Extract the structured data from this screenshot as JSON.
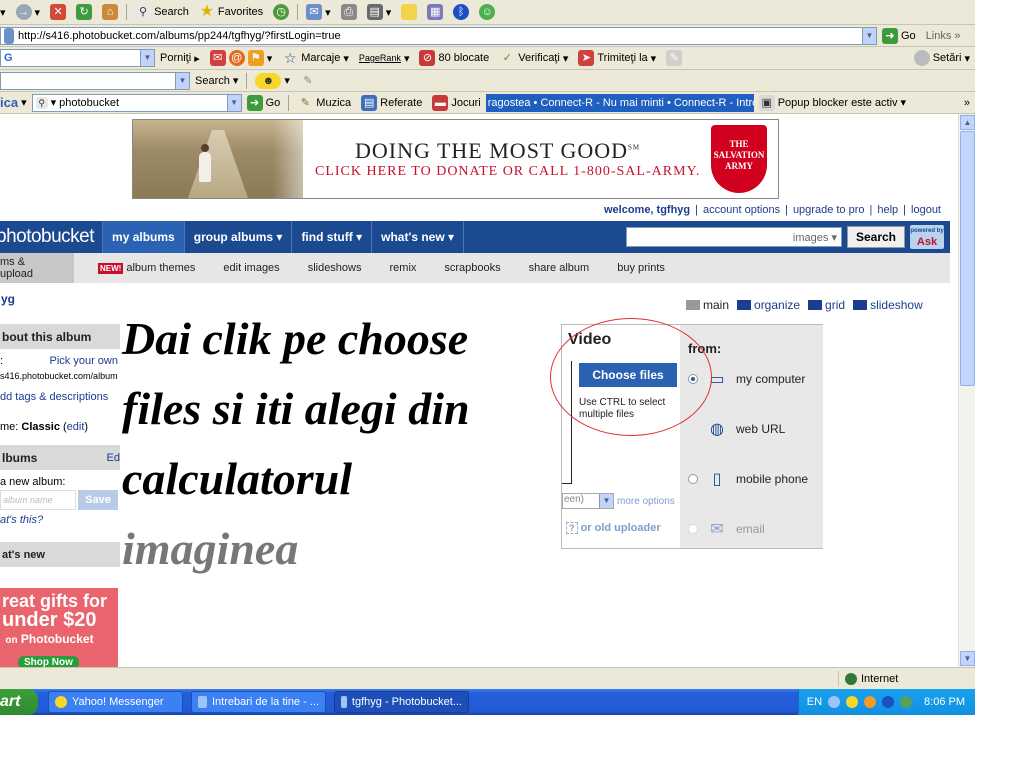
{
  "toolbar1": {
    "search": "Search",
    "favorites": "Favorites"
  },
  "address": {
    "url": "http://s416.photobucket.com/albums/pp244/tgfhyg/?firstLogin=true",
    "go": "Go",
    "links": "Links"
  },
  "google_bar": {
    "engine": "G",
    "porniti": "Porniţi",
    "marcaje": "Marcaje",
    "pagerank": "PageRank",
    "blocate": "80 blocate",
    "verificati": "Verificaţi",
    "trimiteti": "Trimiteţi la",
    "setari": "Setări"
  },
  "search_bar": {
    "search": "Search"
  },
  "links_bar": {
    "left": "ica",
    "search_value": "photobucket",
    "go": "Go",
    "muzica": "Muzica",
    "referate": "Referate",
    "jocuri": "Jocuri",
    "ticker": "ragostea • Connect-R - Nu mai minti • Connect-R - Intro",
    "popup": "Popup blocker este activ"
  },
  "banner": {
    "headline": "Doing the most good",
    "sm": "SM",
    "subline": "Click here to donate or call 1-800-Sal-Army.",
    "logo": "THE SALVATION ARMY"
  },
  "welcome": {
    "greeting": "welcome, tgfhyg",
    "account": "account options",
    "upgrade": "upgrade to pro",
    "help": "help",
    "logout": "logout",
    "sep": "|"
  },
  "nav": {
    "logo": "photobucket",
    "tabs": [
      "my albums",
      "group albums ▾",
      "find stuff ▾",
      "what's new ▾"
    ],
    "search_scope": "images ▾",
    "search_btn": "Search",
    "powered": "powered by",
    "ask": "Ask"
  },
  "subnav": {
    "items": [
      "ms & upload",
      "album themes",
      "edit images",
      "slideshows",
      "remix",
      "scrapbooks",
      "share album",
      "buy prints"
    ],
    "new_badge": "NEW!"
  },
  "sidebar": {
    "user": "yg",
    "about_header": "bout this album",
    "pick_label": ":",
    "pick_link": "Pick your own",
    "url": "s416.photobucket.com/album",
    "tags_link": "dd tags & descriptions",
    "theme_prefix": "me:",
    "theme_value": "Classic",
    "theme_edit": "edit",
    "albums_header": "lbums",
    "albums_edit": "Ed",
    "new_album_label": "a new album:",
    "album_name_placeholder": "album name",
    "save_btn": "Save",
    "whats_this": "at's this?",
    "whats_new": "at's new",
    "gifts_line1": "reat gifts for",
    "gifts_line2": "under $20",
    "gifts_on": "on",
    "gifts_pb": "Photobucket",
    "shop": "Shop Now"
  },
  "views": {
    "main": "main",
    "organize": "organize",
    "grid": "grid",
    "slideshow": "slideshow"
  },
  "annotation": {
    "line1": "Dai clik pe choose",
    "line2": "files si iti alegi din",
    "line3": "calculatorul",
    "line4": "imaginea"
  },
  "upload": {
    "video": "Video",
    "choose_btn": "Choose files",
    "ctrl_hint": "Use CTRL to select multiple files",
    "size_select": "een)",
    "more_options": "more options",
    "old_uploader": "or old uploader",
    "from_label": "from:",
    "options": [
      "my computer",
      "web URL",
      "mobile phone",
      "email"
    ]
  },
  "statusbar": {
    "zone": "Internet"
  },
  "taskbar": {
    "start": "art",
    "tasks": [
      "Yahoo! Messenger",
      "Intrebari de la tine - ...",
      "tgfhyg - Photobucket..."
    ],
    "lang": "EN",
    "time": "8:06 PM"
  },
  "colors": {
    "nav_bg": "#1b4a91",
    "link": "#1b3d8f",
    "choose_btn": "#2c62b4",
    "annotation_circle": "#e03030"
  }
}
